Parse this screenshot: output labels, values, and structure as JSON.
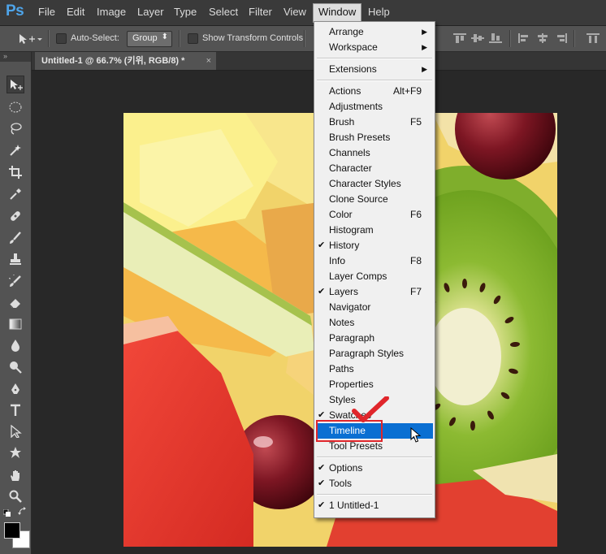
{
  "app": {
    "logo": "Ps",
    "menus": [
      "File",
      "Edit",
      "Image",
      "Layer",
      "Type",
      "Select",
      "Filter",
      "View",
      "Window",
      "Help"
    ],
    "active_menu": "Window"
  },
  "options_bar": {
    "auto_select_label": "Auto-Select:",
    "auto_select_checked": false,
    "group_value": "Group",
    "show_transform_label": "Show Transform Controls",
    "show_transform_checked": false
  },
  "document_tab": {
    "title": "Untitled-1 @ 66.7% (키위, RGB/8) *",
    "close": "×"
  },
  "toolbox": {
    "collapse_glyph": "»",
    "tools": [
      "move-tool",
      "marquee-tool",
      "lasso-tool",
      "magic-wand-tool",
      "crop-tool",
      "eyedropper-tool",
      "healing-brush-tool",
      "brush-tool",
      "clone-stamp-tool",
      "history-brush-tool",
      "eraser-tool",
      "gradient-tool",
      "blur-tool",
      "dodge-tool",
      "pen-tool",
      "type-tool",
      "path-selection-tool",
      "custom-shape-tool",
      "hand-tool",
      "zoom-tool"
    ],
    "selected_tool": "move-tool"
  },
  "window_menu": {
    "groups": [
      [
        {
          "label": "Arrange",
          "submenu": true
        },
        {
          "label": "Workspace",
          "submenu": true
        }
      ],
      [
        {
          "label": "Extensions",
          "submenu": true
        }
      ],
      [
        {
          "label": "Actions",
          "shortcut": "Alt+F9"
        },
        {
          "label": "Adjustments"
        },
        {
          "label": "Brush",
          "shortcut": "F5"
        },
        {
          "label": "Brush Presets"
        },
        {
          "label": "Channels"
        },
        {
          "label": "Character"
        },
        {
          "label": "Character Styles"
        },
        {
          "label": "Clone Source"
        },
        {
          "label": "Color",
          "shortcut": "F6"
        },
        {
          "label": "Histogram"
        },
        {
          "label": "History",
          "checked": true
        },
        {
          "label": "Info",
          "shortcut": "F8"
        },
        {
          "label": "Layer Comps"
        },
        {
          "label": "Layers",
          "shortcut": "F7",
          "checked": true
        },
        {
          "label": "Navigator"
        },
        {
          "label": "Notes"
        },
        {
          "label": "Paragraph"
        },
        {
          "label": "Paragraph Styles"
        },
        {
          "label": "Paths"
        },
        {
          "label": "Properties"
        },
        {
          "label": "Styles"
        },
        {
          "label": "Swatches",
          "checked": true
        },
        {
          "label": "Timeline",
          "highlighted": true
        },
        {
          "label": "Tool Presets"
        }
      ],
      [
        {
          "label": "Options",
          "checked": true
        },
        {
          "label": "Tools",
          "checked": true
        }
      ],
      [
        {
          "label": "1 Untitled-1",
          "checked": true
        }
      ]
    ],
    "check_glyph": "✔",
    "submenu_glyph": "▶",
    "highlight_color": "#0a6fd2"
  },
  "annotation_color": "#e0262b",
  "canvas_subject": "fruit-photo-kiwi"
}
